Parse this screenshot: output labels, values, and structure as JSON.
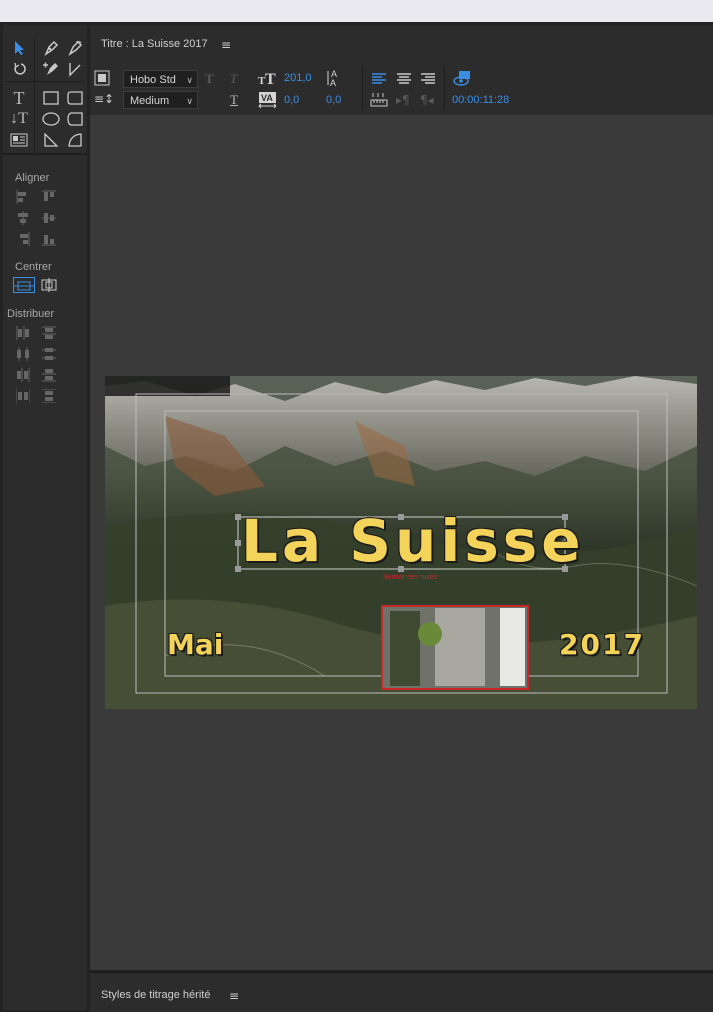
{
  "panel": {
    "title": "Titre : La Suisse 2017",
    "menu_icon": "hamburger-icon"
  },
  "toolbar": {
    "font_family": "Hobo Std",
    "font_style": "Medium",
    "font_size": "201,0",
    "leading": "0,0",
    "kerning": "0,0",
    "timecode": "00:00:11:28"
  },
  "tools": {
    "aligner": "Aligner",
    "centrer": "Centrer",
    "distribuer": "Distribuer"
  },
  "canvas": {
    "main_title": "La Suisse",
    "month": "Mai",
    "year": "2017",
    "small_caption": "Sentier des ruses",
    "title_color": "#f3d35a",
    "outline_color": "#1a1a1a",
    "photo_border_color": "#c8282a"
  },
  "bottom_panel": {
    "title": "Styles de titrage hérité"
  },
  "colors": {
    "accent": "#3a8ee6",
    "panel_bg": "#2c2c2c",
    "work_bg": "#3a3a3a"
  }
}
